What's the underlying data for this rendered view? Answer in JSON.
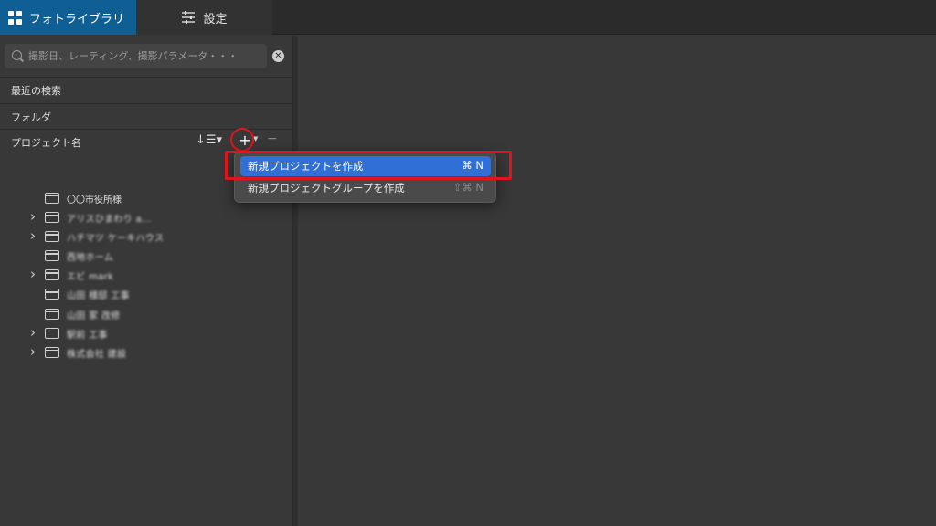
{
  "tabs": [
    {
      "label": "フォトライブラリ",
      "active": true
    },
    {
      "label": "設定",
      "active": false
    }
  ],
  "search": {
    "placeholder": "撮影日、レーティング、撮影パラメータ・・・",
    "value": ""
  },
  "sections": {
    "recent": "最近の検索",
    "folder": "フォルダ",
    "project": "プロジェクト名"
  },
  "tree": [
    {
      "label": "〇〇市役所様",
      "expandable": false,
      "blurred": false
    },
    {
      "label": "アリスひまわり a...",
      "expandable": true,
      "blurred": true
    },
    {
      "label": "ハチマツ ケーキハウス",
      "expandable": true,
      "blurred": true
    },
    {
      "label": "西地ホーム",
      "expandable": false,
      "blurred": true
    },
    {
      "label": "エビ mark",
      "expandable": true,
      "blurred": true
    },
    {
      "label": "山田 様邸 工事",
      "expandable": false,
      "blurred": true
    },
    {
      "label": "山田 家 改修",
      "expandable": false,
      "blurred": true
    },
    {
      "label": "駅前 工事",
      "expandable": true,
      "blurred": true
    },
    {
      "label": "株式会社 建設",
      "expandable": true,
      "blurred": true
    }
  ],
  "menu": {
    "items": [
      {
        "label": "新規プロジェクトを作成",
        "shortcut": "⌘ N",
        "selected": true
      },
      {
        "label": "新規プロジェクトグループを作成",
        "shortcut": "⇧⌘ N",
        "selected": false
      }
    ]
  },
  "colors": {
    "accent_tab": "#0f5e94",
    "menu_selected": "#2f6fd6",
    "annotation": "#e0141a"
  }
}
